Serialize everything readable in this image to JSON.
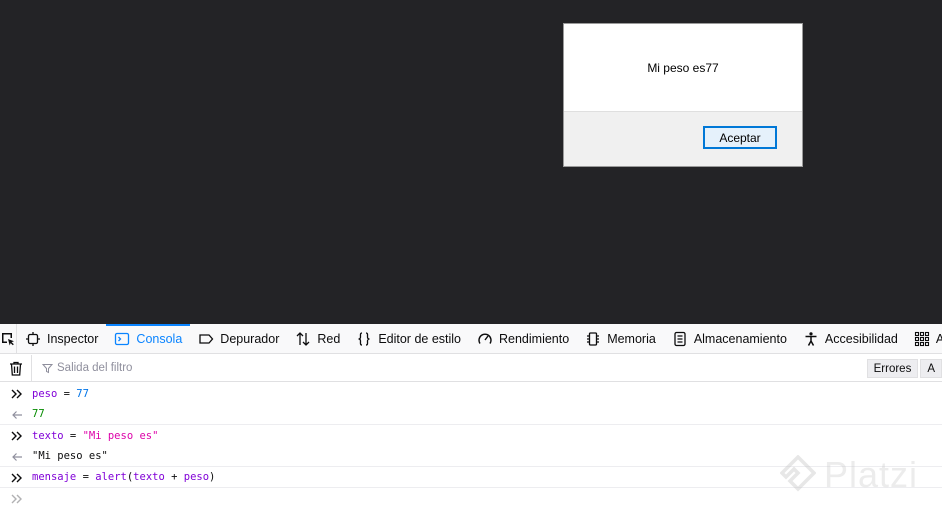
{
  "alert": {
    "message": "Mi peso es77",
    "ok_label": "Aceptar"
  },
  "toolbar": {
    "tabs": [
      {
        "label": "Inspector",
        "icon": "inspector-icon"
      },
      {
        "label": "Consola",
        "icon": "console-icon",
        "active": true
      },
      {
        "label": "Depurador",
        "icon": "debugger-icon"
      },
      {
        "label": "Red",
        "icon": "network-icon"
      },
      {
        "label": "Editor de estilo",
        "icon": "style-editor-icon"
      },
      {
        "label": "Rendimiento",
        "icon": "performance-icon"
      },
      {
        "label": "Memoria",
        "icon": "memory-icon"
      },
      {
        "label": "Almacenamiento",
        "icon": "storage-icon"
      },
      {
        "label": "Accesibilidad",
        "icon": "accessibility-icon"
      },
      {
        "label": "Ap",
        "icon": "application-icon"
      }
    ]
  },
  "filterbar": {
    "placeholder": "Salida del filtro",
    "levels": [
      "Errores",
      "A"
    ]
  },
  "console": {
    "entries": [
      {
        "kind": "input",
        "tokens": [
          [
            "var",
            "peso"
          ],
          [
            "op",
            " = "
          ],
          [
            "num",
            "77"
          ]
        ]
      },
      {
        "kind": "result",
        "tokens": [
          [
            "rnum",
            "77"
          ]
        ]
      },
      {
        "kind": "input",
        "tokens": [
          [
            "var",
            "texto"
          ],
          [
            "op",
            " = "
          ],
          [
            "str",
            "\"Mi peso es\""
          ]
        ]
      },
      {
        "kind": "result",
        "tokens": [
          [
            "rstr",
            "\"Mi peso es\""
          ]
        ]
      },
      {
        "kind": "input",
        "tokens": [
          [
            "var",
            "mensaje"
          ],
          [
            "op",
            " = "
          ],
          [
            "var",
            "alert"
          ],
          [
            "op",
            "("
          ],
          [
            "var",
            "texto"
          ],
          [
            "op",
            " + "
          ],
          [
            "var",
            "peso"
          ],
          [
            "op",
            ")"
          ]
        ]
      }
    ]
  },
  "watermark": {
    "text": "Platzi"
  },
  "colors": {
    "accent": "#0a84ff",
    "viewport_bg": "#232326"
  }
}
